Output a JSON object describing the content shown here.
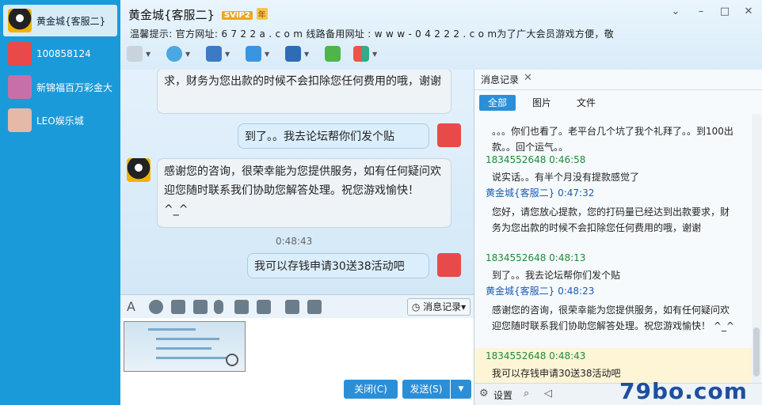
{
  "sidebar": {
    "contacts": [
      {
        "name": "黄金城{客服二}",
        "active": true
      },
      {
        "name": "100858124",
        "active": false
      },
      {
        "name": "新锦福百万彩金大",
        "active": false
      },
      {
        "name": "LEO娱乐城",
        "active": false
      }
    ]
  },
  "header": {
    "title": "黄金城{客服二}",
    "vip_badge": "SVIP2",
    "year_badge": "年",
    "notice": "温馨提示: 官方网址: 6 7 2 2 a . c o m  线路备用网址 :  w w w - 0 4 2 2 2 . c o m为了广大会员游戏方便，敬",
    "window_controls": [
      "chevron-down-icon",
      "minimize-icon",
      "maximize-icon",
      "close-icon"
    ]
  },
  "toolbar": {
    "icons": [
      "microphone-icon",
      "video-camera-icon",
      "screen-share-icon",
      "file-transfer-icon",
      "remote-assist-icon",
      "add-contact-icon",
      "apps-icon"
    ]
  },
  "chat": {
    "messages": [
      {
        "from": "other",
        "text": "求，财务为您出款的时候不会扣除您任何费用的哦，谢谢"
      },
      {
        "from": "me",
        "text": "到了。。我去论坛帮你们发个贴"
      },
      {
        "from": "other",
        "text": "感谢您的咨询，很荣幸能为您提供服务，如有任何疑问欢迎您随时联系我们协助您解答处理。祝您游戏愉快！ ^_^"
      },
      {
        "from": "me",
        "text": "我可以存钱申请30送38活动吧"
      }
    ],
    "time": "0:48:43"
  },
  "input_toolbar": {
    "icons": [
      "font-icon",
      "emoji-icon",
      "magic-icon",
      "shake-icon",
      "voice-icon",
      "edit-icon",
      "image-icon",
      "music-icon",
      "scissors-icon"
    ],
    "history_button": "消息记录"
  },
  "actions": {
    "close_label": "关闭(C)",
    "send_label": "发送(S)"
  },
  "history": {
    "tab_label": "消息记录",
    "filters": [
      "全部",
      "图片",
      "文件"
    ],
    "entries": [
      {
        "type": "msg",
        "text": "。。。你们也看了。老平台几个坑了我个礼拜了。。到100出款。。回个运气。。"
      },
      {
        "type": "name",
        "kf": false,
        "text": "1834552648 0:46:58"
      },
      {
        "type": "msg",
        "text": "说实话。。有半个月没有提款感觉了"
      },
      {
        "type": "name",
        "kf": true,
        "text": "黄金城{客服二} 0:47:32"
      },
      {
        "type": "msg",
        "text": "您好，请您放心提款，您的打码量已经达到出款要求，财务为您出款的时候不会扣除您任何费用的哦，谢谢"
      },
      {
        "type": "name",
        "kf": false,
        "text": "1834552648 0:48:13"
      },
      {
        "type": "msg",
        "text": "到了。。我去论坛帮你们发个贴"
      },
      {
        "type": "name",
        "kf": true,
        "text": "黄金城{客服二} 0:48:23"
      },
      {
        "type": "msg",
        "text": "感谢您的咨询，很荣幸能为您提供服务，如有任何疑问欢迎您随时联系我们协助您解答处理。祝您游戏愉快！ ^_^"
      },
      {
        "type": "name",
        "kf": false,
        "text": "1834552648 0:48:43"
      },
      {
        "type": "msg",
        "text": "我可以存钱申请30送38活动吧"
      }
    ],
    "settings_label": "设置"
  },
  "watermark": "79bo.com"
}
